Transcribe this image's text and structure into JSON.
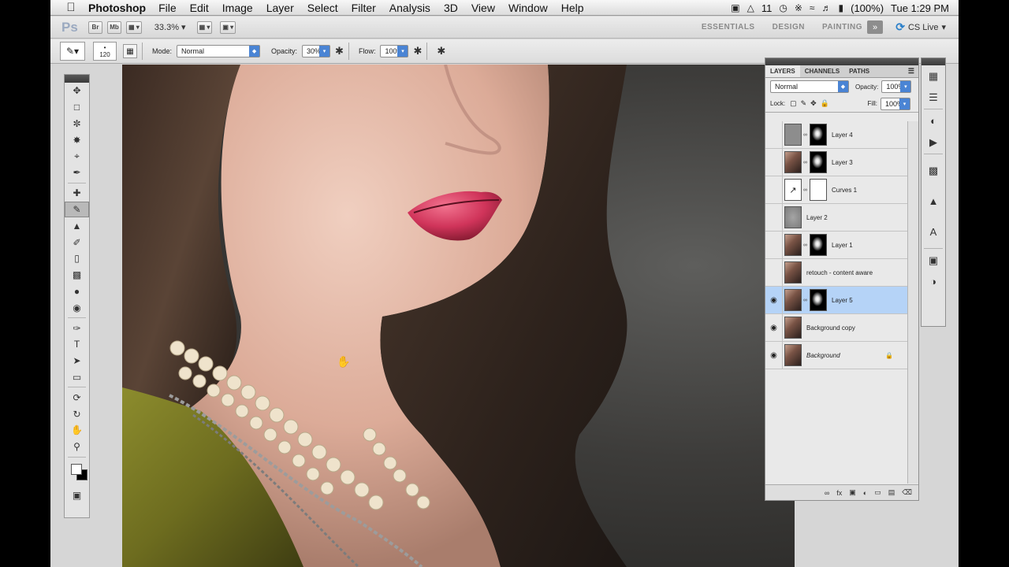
{
  "menubar": {
    "app_name": "Photoshop",
    "items": [
      "File",
      "Edit",
      "Image",
      "Layer",
      "Select",
      "Filter",
      "Analysis",
      "3D",
      "View",
      "Window",
      "Help"
    ],
    "status": {
      "notifications": "11",
      "battery": "(100%)",
      "clock": "Tue 1:29 PM"
    }
  },
  "appbar": {
    "logo": "Ps",
    "bridge": "Br",
    "minibridge": "Mb",
    "zoom": "33.3%",
    "workspaces": [
      "ESSENTIALS",
      "DESIGN",
      "PAINTING"
    ],
    "more": "»",
    "cs_live": "CS Live"
  },
  "options": {
    "brush_size": "120",
    "mode_label": "Mode:",
    "mode_value": "Normal",
    "opacity_label": "Opacity:",
    "opacity_value": "30%",
    "flow_label": "Flow:",
    "flow_value": "100%"
  },
  "layers_panel": {
    "tabs": [
      "LAYERS",
      "CHANNELS",
      "PATHS"
    ],
    "blend_mode": "Normal",
    "opacity_label": "Opacity:",
    "opacity_value": "100%",
    "lock_label": "Lock:",
    "fill_label": "Fill:",
    "fill_value": "100%",
    "layers": [
      {
        "name": "Layer 4",
        "visible": false,
        "thumb": "grey",
        "mask": "black"
      },
      {
        "name": "Layer 3",
        "visible": false,
        "thumb": "photo",
        "mask": "black"
      },
      {
        "name": "Curves 1",
        "visible": false,
        "thumb": "curves",
        "mask": "white"
      },
      {
        "name": "Layer 2",
        "visible": false,
        "thumb": "greyblur",
        "mask": ""
      },
      {
        "name": "Layer 1",
        "visible": false,
        "thumb": "photo",
        "mask": "black"
      },
      {
        "name": "retouch - content aware",
        "visible": false,
        "thumb": "photo",
        "mask": ""
      },
      {
        "name": "Layer 5",
        "visible": true,
        "thumb": "photo",
        "mask": "black",
        "selected": true
      },
      {
        "name": "Background copy",
        "visible": true,
        "thumb": "photo",
        "mask": ""
      },
      {
        "name": "Background",
        "visible": true,
        "thumb": "photo",
        "mask": "",
        "locked": true
      }
    ]
  },
  "colors": {
    "accent_blue": "#4a84d4",
    "selection": "#b5d3f7"
  }
}
